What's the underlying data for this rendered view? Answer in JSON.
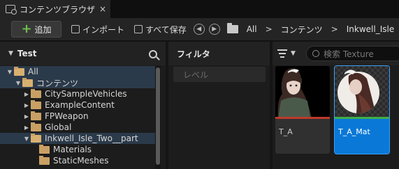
{
  "tab": {
    "title": "コンテンツブラウザ",
    "close": "×"
  },
  "toolbar": {
    "add_label": "追加",
    "import_label": "インポート",
    "save_all_label": "すべて保存",
    "breadcrumbs": [
      "All",
      "コンテンツ",
      "Inkwell_Isle"
    ]
  },
  "sources": {
    "title": "Test",
    "tree": [
      {
        "label": "All",
        "depth": 0,
        "expanded": true
      },
      {
        "label": "コンテンツ",
        "depth": 1,
        "expanded": true
      },
      {
        "label": "CitySampleVehicles",
        "depth": 2,
        "expanded": false
      },
      {
        "label": "ExampleContent",
        "depth": 2,
        "expanded": false
      },
      {
        "label": "FPWeapon",
        "depth": 2,
        "expanded": false
      },
      {
        "label": "Global",
        "depth": 2,
        "expanded": false
      },
      {
        "label": "Inkwell_Isle_Two__part",
        "depth": 2,
        "expanded": true
      },
      {
        "label": "Materials",
        "depth": 3
      },
      {
        "label": "StaticMeshes",
        "depth": 3
      }
    ]
  },
  "filters": {
    "title": "フィルタ",
    "level_label": "レベル"
  },
  "assets": {
    "search_placeholder": "検索 Texture",
    "items": [
      {
        "name": "T_A",
        "type_color": "#c0392b",
        "selected": false
      },
      {
        "name": "T_A_Mat",
        "type_color": "#3fae49",
        "selected": true
      }
    ]
  }
}
